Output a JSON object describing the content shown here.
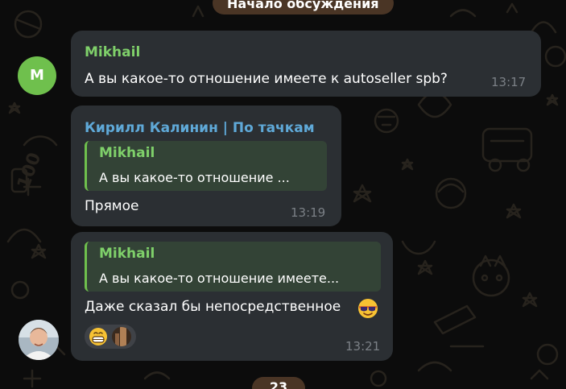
{
  "service_messages": {
    "top": "Начало обсуждения",
    "bottom": "23"
  },
  "colors": {
    "background": "#0c0c0c",
    "doodle": "#27231d",
    "bubble": "#2b2f33",
    "service_pill": "#4a3525",
    "sender_green": "#7fd06a",
    "sender_blue": "#5fa9d8",
    "reply_bg": "#334336",
    "timestamp": "#7b8086"
  },
  "messages": [
    {
      "avatar_initial": "M",
      "sender": "Mikhail",
      "text": "А вы какое-то отношение имеете к autoseller spb?",
      "time": "13:17"
    },
    {
      "sender": "Кирилл Калинин | По тачкам",
      "reply": {
        "name": "Mikhail",
        "text": "А вы какое-то отношение ..."
      },
      "text": "Прямое",
      "time": "13:19"
    },
    {
      "reply": {
        "name": "Mikhail",
        "text": "А вы какое-то отношение имеете..."
      },
      "text": "Даже сказал бы непосредственное",
      "emoji": "cool-sunglasses-emoji",
      "reaction": {
        "emoji": "grinning-face-emoji",
        "user": "user-avatar"
      },
      "time": "13:21"
    }
  ]
}
